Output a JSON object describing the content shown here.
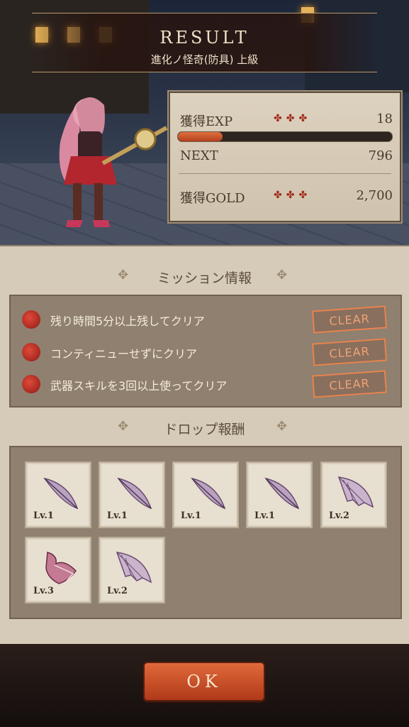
{
  "header": {
    "title": "RESULT",
    "subtitle": "進化ノ怪奇(防具) 上級"
  },
  "stats": {
    "exp_label": "獲得EXP",
    "exp_value": "18",
    "next_label": "NEXT",
    "next_value": "796",
    "gold_label": "獲得GOLD",
    "gold_value": "2,700",
    "exp_progress": 0.21,
    "rating_glyph": "✤✤✤"
  },
  "missions": {
    "title": "ミッション情報",
    "items": [
      {
        "text": "残り時間5分以上残してクリア",
        "status": "CLEAR"
      },
      {
        "text": "コンティニューせずにクリア",
        "status": "CLEAR"
      },
      {
        "text": "武器スキルを3回以上使ってクリア",
        "status": "CLEAR"
      }
    ]
  },
  "drops": {
    "title": "ドロップ報酬",
    "items": [
      {
        "level": "Lv.1",
        "icon": "feather-icon"
      },
      {
        "level": "Lv.1",
        "icon": "feather-icon"
      },
      {
        "level": "Lv.1",
        "icon": "feather-icon"
      },
      {
        "level": "Lv.1",
        "icon": "feather-icon"
      },
      {
        "level": "Lv.2",
        "icon": "wing-icon"
      },
      {
        "level": "Lv.3",
        "icon": "winged-creature-icon"
      },
      {
        "level": "Lv.2",
        "icon": "wing-icon"
      }
    ]
  },
  "footer": {
    "ok_label": "OK"
  },
  "colors": {
    "accent": "#c64a22",
    "clear": "#e9834e",
    "panel": "#d6cbb9"
  }
}
